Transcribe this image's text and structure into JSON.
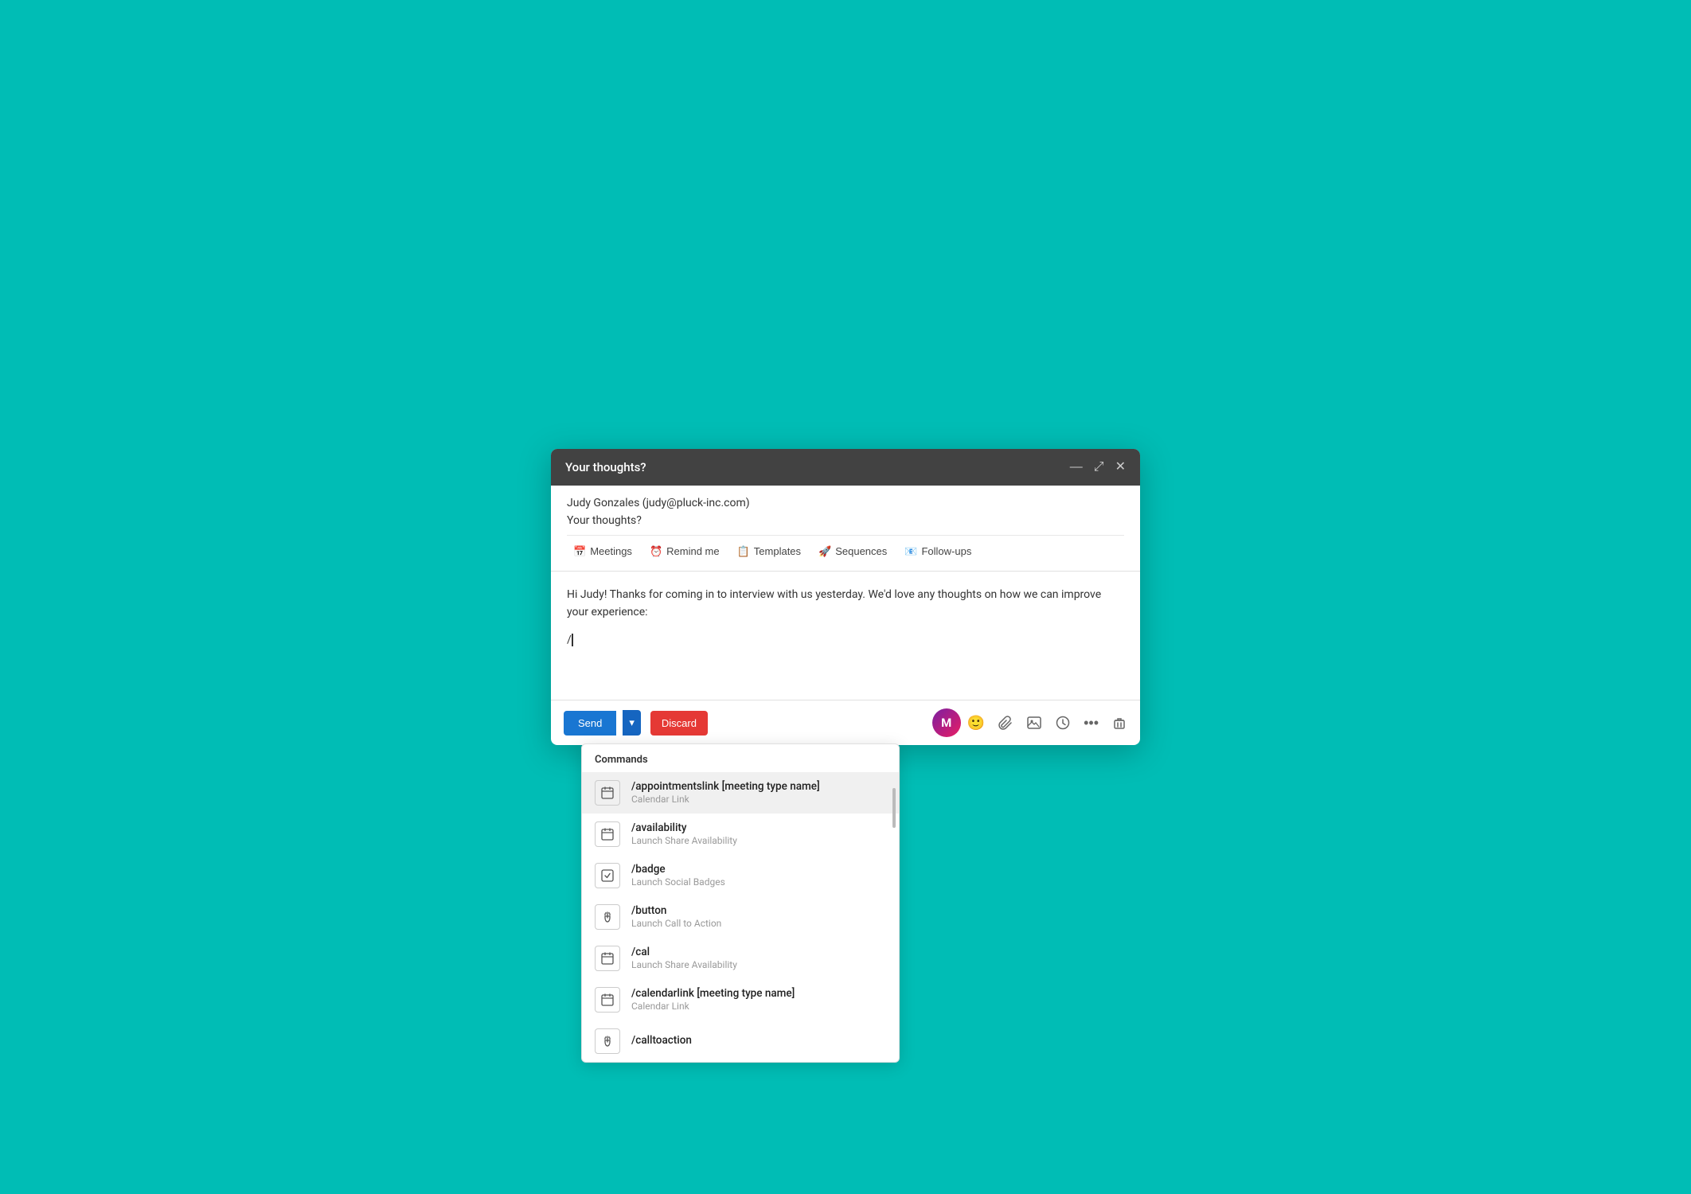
{
  "window": {
    "title": "Your thoughts?"
  },
  "title_bar_controls": {
    "minimize": "—",
    "expand": "⤢",
    "close": "✕"
  },
  "email": {
    "to": "Judy Gonzales (judy@pluck-inc.com)",
    "subject": "Your thoughts?",
    "body_line1": "Hi Judy! Thanks for coming in to interview with us yesterday. We'd love any thoughts on how we can improve your experience:",
    "cursor_text": "/"
  },
  "toolbar": {
    "items": [
      {
        "icon": "📅",
        "label": "Meetings"
      },
      {
        "icon": "⏰",
        "label": "Remind me"
      },
      {
        "icon": "📋",
        "label": "Templates"
      },
      {
        "icon": "🚀",
        "label": "Sequences"
      },
      {
        "icon": "📧",
        "label": "Follow-ups"
      }
    ]
  },
  "commands": {
    "header": "Commands",
    "items": [
      {
        "name": "/appointmentslink [meeting type name]",
        "desc": "Calendar Link",
        "icon": "calendar",
        "highlighted": true
      },
      {
        "name": "/availability",
        "desc": "Launch Share Availability",
        "icon": "calendar",
        "highlighted": false
      },
      {
        "name": "/badge",
        "desc": "Launch Social Badges",
        "icon": "badge",
        "highlighted": false
      },
      {
        "name": "/button",
        "desc": "Launch Call to Action",
        "icon": "hand",
        "highlighted": false
      },
      {
        "name": "/cal",
        "desc": "Launch Share Availability",
        "icon": "calendar",
        "highlighted": false
      },
      {
        "name": "/calendarlink [meeting type name]",
        "desc": "Calendar Link",
        "icon": "calendar",
        "highlighted": false
      },
      {
        "name": "/calltoaction",
        "desc": "",
        "icon": "hand",
        "highlighted": false
      }
    ]
  },
  "footer": {
    "send_label": "Send",
    "discard_label": "Discard",
    "icons": [
      "emoji",
      "attach",
      "image",
      "schedule",
      "more",
      "delete"
    ],
    "avatar_initial": "M"
  }
}
